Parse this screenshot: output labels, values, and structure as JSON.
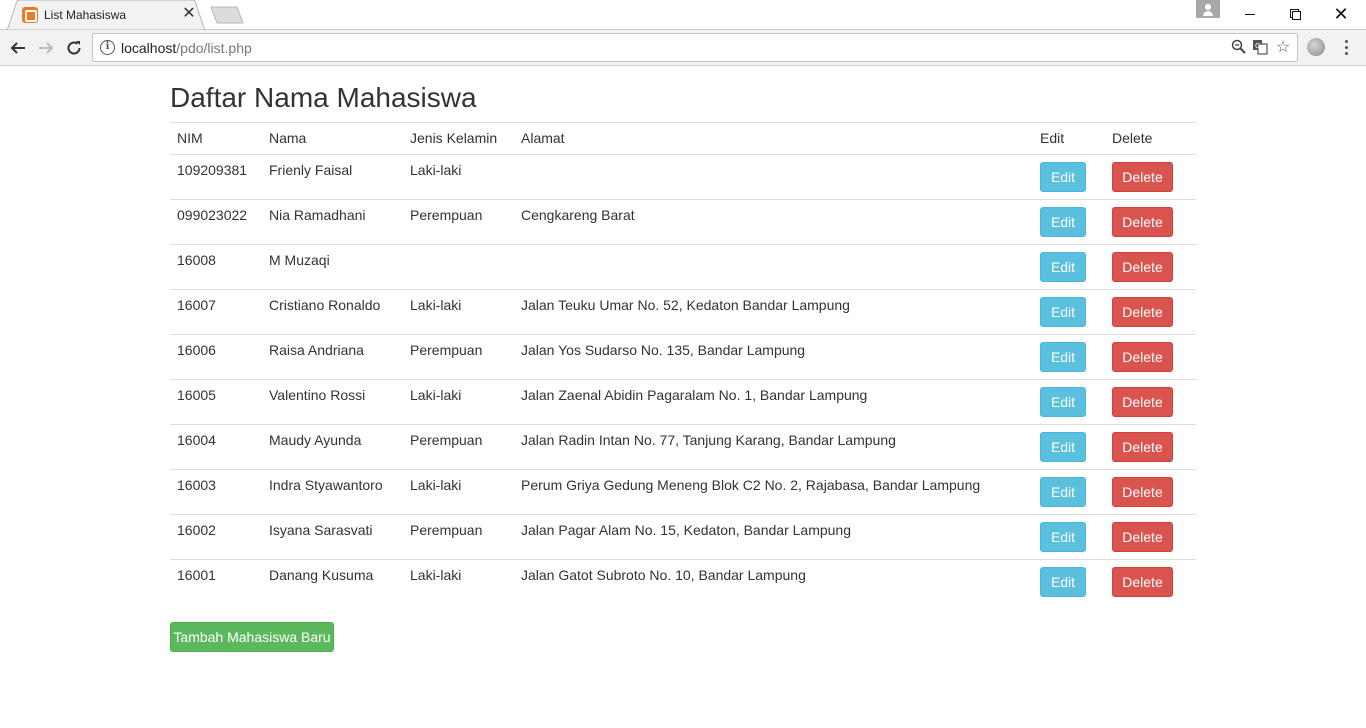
{
  "browser": {
    "tab_title": "List Mahasiswa",
    "url_host": "localhost",
    "url_path": "/pdo/list.php"
  },
  "page": {
    "title": "Daftar Nama Mahasiswa",
    "add_button": "Tambah Mahasiswa Baru"
  },
  "table": {
    "headers": {
      "nim": "NIM",
      "nama": "Nama",
      "jenis_kelamin": "Jenis Kelamin",
      "alamat": "Alamat",
      "edit": "Edit",
      "delete": "Delete"
    },
    "edit_label": "Edit",
    "delete_label": "Delete",
    "rows": [
      {
        "nim": "109209381",
        "nama": "Frienly Faisal",
        "jenis_kelamin": "Laki-laki",
        "alamat": ""
      },
      {
        "nim": "099023022",
        "nama": "Nia Ramadhani",
        "jenis_kelamin": "Perempuan",
        "alamat": "Cengkareng Barat"
      },
      {
        "nim": "16008",
        "nama": "M Muzaqi",
        "jenis_kelamin": "",
        "alamat": ""
      },
      {
        "nim": "16007",
        "nama": "Cristiano Ronaldo",
        "jenis_kelamin": "Laki-laki",
        "alamat": "Jalan Teuku Umar No. 52, Kedaton Bandar Lampung"
      },
      {
        "nim": "16006",
        "nama": "Raisa Andriana",
        "jenis_kelamin": "Perempuan",
        "alamat": "Jalan Yos Sudarso No. 135, Bandar Lampung"
      },
      {
        "nim": "16005",
        "nama": "Valentino Rossi",
        "jenis_kelamin": "Laki-laki",
        "alamat": "Jalan Zaenal Abidin Pagaralam No. 1, Bandar Lampung"
      },
      {
        "nim": "16004",
        "nama": "Maudy Ayunda",
        "jenis_kelamin": "Perempuan",
        "alamat": "Jalan Radin Intan No. 77, Tanjung Karang, Bandar Lampung"
      },
      {
        "nim": "16003",
        "nama": "Indra Styawantoro",
        "jenis_kelamin": "Laki-laki",
        "alamat": "Perum Griya Gedung Meneng Blok C2 No. 2, Rajabasa, Bandar Lampung"
      },
      {
        "nim": "16002",
        "nama": "Isyana Sarasvati",
        "jenis_kelamin": "Perempuan",
        "alamat": "Jalan Pagar Alam No. 15, Kedaton, Bandar Lampung"
      },
      {
        "nim": "16001",
        "nama": "Danang Kusuma",
        "jenis_kelamin": "Laki-laki",
        "alamat": "Jalan Gatot Subroto No. 10, Bandar Lampung"
      }
    ]
  },
  "colors": {
    "edit_button": "#5bc0de",
    "delete_button": "#d9534f",
    "add_button": "#5cb85c",
    "favicon": "#f07a22"
  },
  "icons": {
    "tab_favicon": "xampp-favicon-icon",
    "tab_close": "close-icon",
    "back": "arrow-left-icon",
    "forward": "arrow-right-icon",
    "reload": "reload-icon",
    "site_info": "info-icon",
    "zoom": "zoom-icon",
    "translate": "translate-icon",
    "bookmark": "star-icon",
    "extension": "extension-icon",
    "menu": "kebab-menu-icon",
    "profile": "avatar-icon"
  }
}
